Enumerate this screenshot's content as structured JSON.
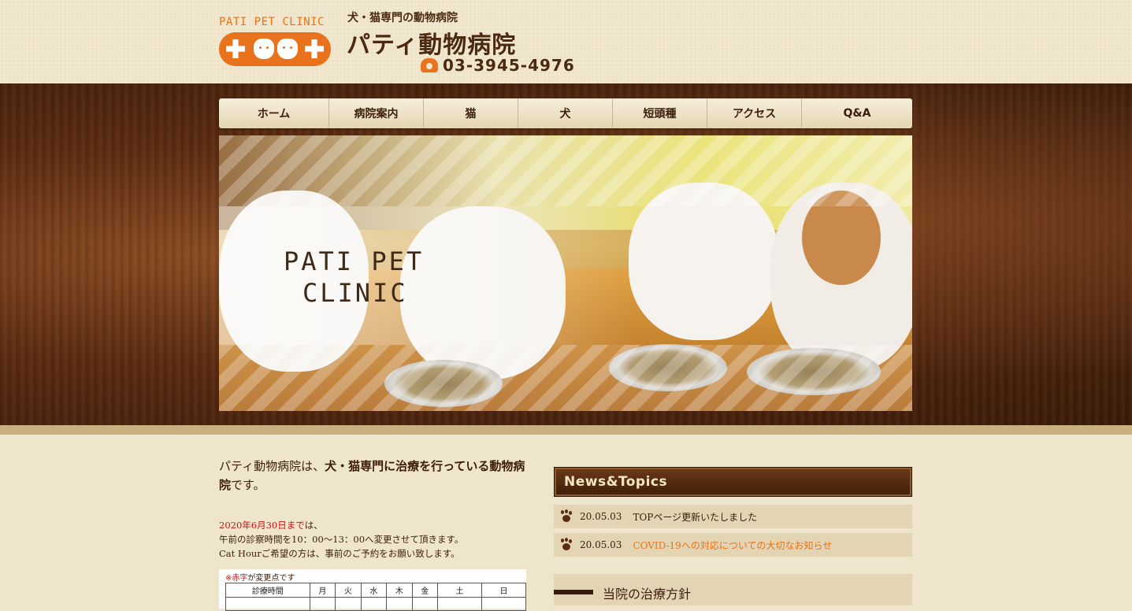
{
  "header": {
    "logo_text": "PATI PET CLINIC",
    "subtitle": "犬・猫専門の動物病院",
    "title": "パティ動物病院",
    "phone": "03-3945-4976"
  },
  "nav": {
    "items": [
      "ホーム",
      "病院案内",
      "猫",
      "犬",
      "短頭種",
      "アクセス",
      "Q&A"
    ]
  },
  "hero": {
    "line1": "PATI PET",
    "line2": "CLINIC"
  },
  "intro": {
    "text_a": "パティ動物病院は、",
    "text_b": "犬・猫専門に治療を行っている動物病院",
    "text_c": "です。"
  },
  "notice": {
    "line1_red": "2020年6月30日まで",
    "line1_rest": "は、",
    "line2": "午前の診察時間を10：00〜13：00へ変更させて頂きます。",
    "line3": "Cat Hourご希望の方は、事前のご予約をお願い致します。"
  },
  "schedule": {
    "note_red": "※赤字",
    "note_rest": "が変更点です",
    "headers": [
      "診療時間",
      "月",
      "火",
      "水",
      "木",
      "金",
      "土",
      "日"
    ]
  },
  "news": {
    "heading": "News&Topics",
    "items": [
      {
        "date": "20.05.03",
        "text": "TOPページ更新いたしました"
      },
      {
        "date": "20.05.03",
        "text": "COVID-19への対応についての大切なお知らせ"
      }
    ]
  },
  "policy": {
    "title": "当院の治療方針"
  },
  "colors": {
    "accent": "#e8731c",
    "brown": "#3a1d0a",
    "red": "#d01010"
  }
}
